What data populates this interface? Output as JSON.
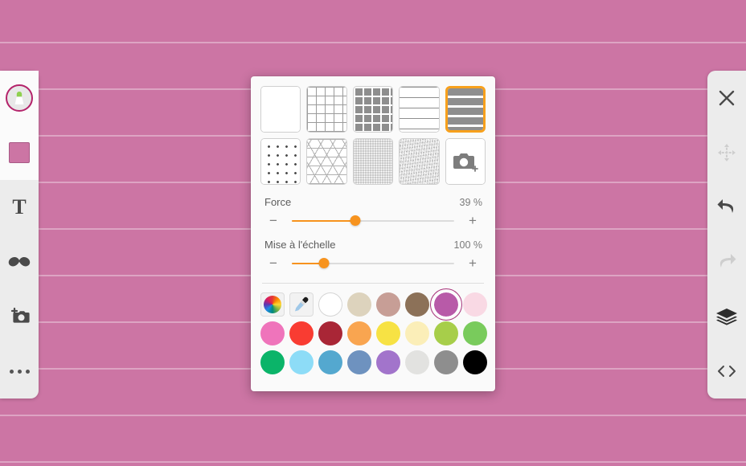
{
  "app": {
    "canvas_color": "#cc75a4",
    "accent_color": "#f7931e",
    "selection_color": "#a8327a"
  },
  "toolbar_left": {
    "items": [
      {
        "name": "brush-tool",
        "icon": "brush-icon",
        "label": "Pinceau",
        "active": true,
        "enabled": true
      },
      {
        "name": "color-tool",
        "icon": "color-swatch-icon",
        "label": "Couleur",
        "active": false,
        "enabled": true,
        "color": "#cc75a4"
      },
      {
        "name": "text-tool",
        "icon": "text-icon",
        "label": "T",
        "active": false,
        "enabled": true
      },
      {
        "name": "sticker-tool",
        "icon": "mustache-icon",
        "label": "Autocollant",
        "active": false,
        "enabled": true
      },
      {
        "name": "photo-tool",
        "icon": "camera-plus-icon",
        "label": "Photo",
        "active": false,
        "enabled": true
      },
      {
        "name": "more-tool",
        "icon": "ellipsis-icon",
        "label": "Plus",
        "active": false,
        "enabled": true
      }
    ]
  },
  "toolbar_right": {
    "items": [
      {
        "name": "close-button",
        "icon": "close-icon",
        "label": "Fermer",
        "enabled": true
      },
      {
        "name": "move-button",
        "icon": "move-icon",
        "label": "Déplacer",
        "enabled": false
      },
      {
        "name": "undo-button",
        "icon": "undo-icon",
        "label": "Annuler",
        "enabled": true
      },
      {
        "name": "redo-button",
        "icon": "redo-icon",
        "label": "Rétablir",
        "enabled": false
      },
      {
        "name": "layers-button",
        "icon": "layers-icon",
        "label": "Calques",
        "enabled": true
      },
      {
        "name": "code-button",
        "icon": "code-icon",
        "label": "Code",
        "enabled": true
      }
    ]
  },
  "pattern_panel": {
    "patterns": [
      {
        "name": "pattern-blank",
        "label": "Vierge",
        "css": "p-blank",
        "selected": false
      },
      {
        "name": "pattern-grid-thin",
        "label": "Grille fine",
        "css": "p-grid-thin",
        "selected": false
      },
      {
        "name": "pattern-grid-bold",
        "label": "Grille épaisse",
        "css": "p-grid-bold",
        "selected": false
      },
      {
        "name": "pattern-lines-thin",
        "label": "Lignes fines",
        "css": "p-lines-thin",
        "selected": false
      },
      {
        "name": "pattern-lines-bold",
        "label": "Lignes épaisses",
        "css": "p-lines-bold",
        "selected": true
      },
      {
        "name": "pattern-dots",
        "label": "Points",
        "css": "p-dots",
        "selected": false
      },
      {
        "name": "pattern-triangles",
        "label": "Triangles",
        "css": "p-tri",
        "selected": false
      },
      {
        "name": "pattern-fine-dots",
        "label": "Texture fine",
        "css": "p-fine",
        "selected": false
      },
      {
        "name": "pattern-noise",
        "label": "Papier",
        "css": "p-noise",
        "selected": false
      },
      {
        "name": "pattern-camera",
        "label": "Importer une photo",
        "css": "p-camera",
        "selected": false,
        "is_camera": true
      }
    ],
    "sliders": [
      {
        "name": "force-slider",
        "label": "Force",
        "value_text": "39 %",
        "value": 39,
        "fill_percent": 39,
        "minus_label": "−",
        "plus_label": "+"
      },
      {
        "name": "scale-slider",
        "label": "Mise à l'échelle",
        "value_text": "100 %",
        "value": 100,
        "fill_percent": 20,
        "minus_label": "−",
        "plus_label": "+"
      }
    ],
    "color_tools": [
      {
        "name": "color-wheel-button",
        "icon": "color-wheel-icon",
        "label": "Roue chromatique"
      },
      {
        "name": "eyedropper-button",
        "icon": "eyedropper-icon",
        "label": "Pipette"
      }
    ],
    "color_rows": [
      [
        {
          "name": "color-white",
          "hex": "#ffffff",
          "selected": false,
          "outlined": true
        },
        {
          "name": "color-beige",
          "hex": "#ddd3bd",
          "selected": false
        },
        {
          "name": "color-rosy-brown",
          "hex": "#c79e96",
          "selected": false
        },
        {
          "name": "color-brown",
          "hex": "#8c7158",
          "selected": false
        },
        {
          "name": "color-orchid",
          "hex": "#b85aa8",
          "selected": true
        },
        {
          "name": "color-pale-pink",
          "hex": "#f9d9e4",
          "selected": false
        }
      ],
      [
        {
          "name": "color-hot-pink",
          "hex": "#ef74bb",
          "selected": false
        },
        {
          "name": "color-red",
          "hex": "#f93c32",
          "selected": false
        },
        {
          "name": "color-dark-red",
          "hex": "#a92636",
          "selected": false
        },
        {
          "name": "color-orange",
          "hex": "#f9a550",
          "selected": false
        },
        {
          "name": "color-yellow",
          "hex": "#f7e244",
          "selected": false
        },
        {
          "name": "color-pale-yellow",
          "hex": "#fbeeb8",
          "selected": false
        },
        {
          "name": "color-lime",
          "hex": "#a7ce4a",
          "selected": false
        },
        {
          "name": "color-green",
          "hex": "#79cb5c",
          "selected": false
        }
      ],
      [
        {
          "name": "color-emerald",
          "hex": "#0bb469",
          "selected": false
        },
        {
          "name": "color-sky-blue",
          "hex": "#8ddcf7",
          "selected": false
        },
        {
          "name": "color-blue",
          "hex": "#54a8cf",
          "selected": false
        },
        {
          "name": "color-steel-blue",
          "hex": "#6e92bf",
          "selected": false
        },
        {
          "name": "color-purple",
          "hex": "#a274cb",
          "selected": false
        },
        {
          "name": "color-light-gray",
          "hex": "#e2e2e0",
          "selected": false
        },
        {
          "name": "color-gray",
          "hex": "#8e8e8e",
          "selected": false
        },
        {
          "name": "color-black",
          "hex": "#000000",
          "selected": false
        }
      ]
    ]
  }
}
